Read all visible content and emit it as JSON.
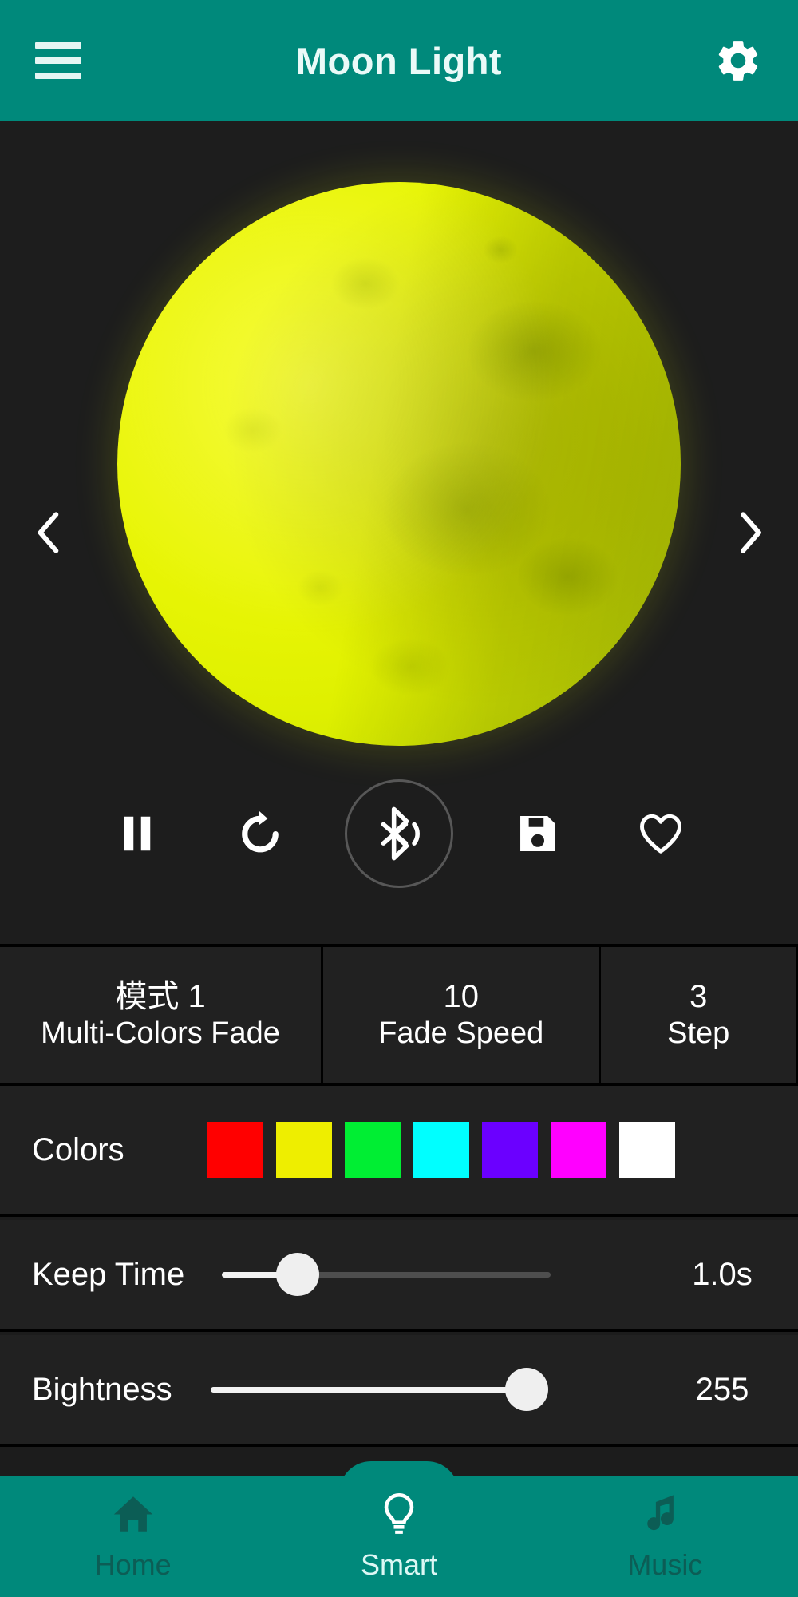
{
  "header": {
    "title": "Moon Light",
    "menu_icon": "hamburger-menu-icon",
    "settings_icon": "gear-icon",
    "background": "#00897B"
  },
  "stage": {
    "prev_icon": "chevron-left-icon",
    "next_icon": "chevron-right-icon",
    "lamp_color": "#E8F500",
    "background": "#1D1D1D"
  },
  "controls": [
    {
      "name": "pause-button",
      "icon": "pause-icon"
    },
    {
      "name": "refresh-button",
      "icon": "refresh-icon"
    },
    {
      "name": "bluetooth-audio-button",
      "icon": "bluetooth-audio-icon"
    },
    {
      "name": "save-button",
      "icon": "save-floppy-icon"
    },
    {
      "name": "favorite-button",
      "icon": "heart-outline-icon"
    }
  ],
  "mode_row": [
    {
      "value": "模式  1",
      "label": "Multi-Colors Fade"
    },
    {
      "value": "10",
      "label": "Fade Speed"
    },
    {
      "value": "3",
      "label": "Step"
    }
  ],
  "colors": {
    "label": "Colors",
    "swatches": [
      {
        "name": "red",
        "hex": "#FF0000"
      },
      {
        "name": "yellow",
        "hex": "#EEEE00"
      },
      {
        "name": "green",
        "hex": "#00EE33"
      },
      {
        "name": "cyan",
        "hex": "#00FFFF"
      },
      {
        "name": "violet",
        "hex": "#6B00FF"
      },
      {
        "name": "magenta",
        "hex": "#FF00FF"
      },
      {
        "name": "white",
        "hex": "#FFFFFF"
      }
    ]
  },
  "sliders": {
    "keep_time": {
      "label": "Keep Time",
      "value": "1.0s",
      "percent": 18
    },
    "brightness": {
      "label": "Bightness",
      "value": "255",
      "percent": 100
    }
  },
  "bottom_nav": {
    "items": [
      {
        "label": "Home",
        "icon": "home-icon",
        "active": false
      },
      {
        "label": "Smart",
        "icon": "bulb-icon",
        "active": true
      },
      {
        "label": "Music",
        "icon": "music-note-icon",
        "active": false
      }
    ],
    "background": "#00897B",
    "active_color": "#DCF7F4",
    "inactive_color": "#0C5D55"
  }
}
